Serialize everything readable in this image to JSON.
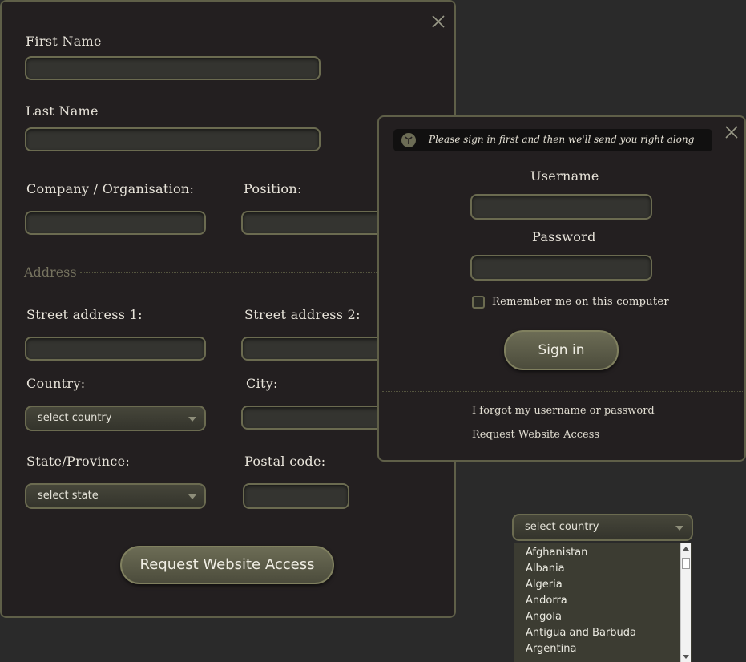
{
  "registration": {
    "first_name_label": "First Name",
    "last_name_label": "Last Name",
    "company_label": "Company / Organisation:",
    "position_label": "Position:",
    "address_section": "Address",
    "street1_label": "Street address 1:",
    "street2_label": "Street address 2:",
    "country_label": "Country:",
    "city_label": "City:",
    "country_select": "select country",
    "state_label": "State/Province:",
    "postal_label": "Postal code:",
    "state_select": "select state",
    "submit_label": "Request Website Access"
  },
  "signin": {
    "notice": "Please sign in first and then we'll send you right along",
    "username_label": "Username",
    "password_label": "Password",
    "remember_label": "Remember me on this computer",
    "signin_button": "Sign in",
    "forgot_link": "I forgot my username or password",
    "request_link": "Request Website Access"
  },
  "country_dropdown": {
    "selected": "select country",
    "options": [
      "Afghanistan",
      "Albania",
      "Algeria",
      "Andorra",
      "Angola",
      "Antigua and Barbuda",
      "Argentina"
    ]
  },
  "colors": {
    "panel_bg": "#231f20",
    "border": "#5f5f48",
    "button": "#5c5c48",
    "page_bg": "#2a2a2a"
  }
}
